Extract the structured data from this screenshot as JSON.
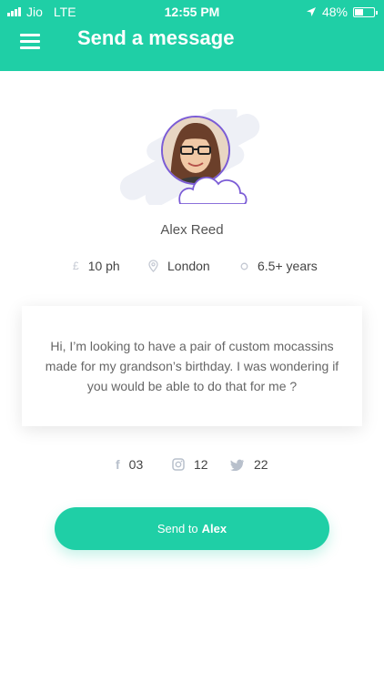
{
  "status_bar": {
    "carrier": "Jio",
    "network": "LTE",
    "time": "12:55 PM",
    "battery": "48%",
    "battery_level": 0.48
  },
  "header": {
    "title": "Send a message"
  },
  "profile": {
    "name": "Alex Reed"
  },
  "stats": [
    {
      "icon": "pound-icon",
      "value": "10 ph"
    },
    {
      "icon": "location-pin-icon",
      "value": "London"
    },
    {
      "icon": "circle-icon",
      "value": "6.5+ years"
    }
  ],
  "message": {
    "text": "Hi, I’m looking to have a pair of custom mocassins made for my grandson’s birthday. I was wondering if you would be able to do that for me ?"
  },
  "socials": [
    {
      "icon": "facebook-icon",
      "count": "03"
    },
    {
      "icon": "instagram-icon",
      "count": "12"
    },
    {
      "icon": "twitter-icon",
      "count": "22"
    }
  ],
  "send_button": {
    "prefix": "Send to",
    "recipient": "Alex"
  },
  "colors": {
    "accent": "#1fcfa6",
    "avatar_ring": "#7b5cd6"
  }
}
